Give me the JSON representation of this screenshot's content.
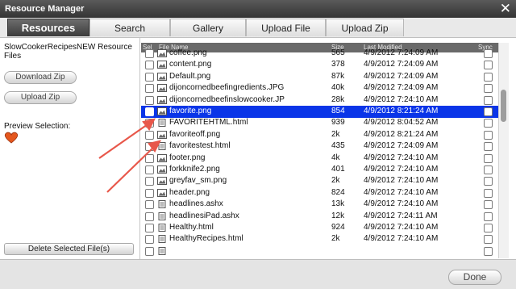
{
  "window": {
    "title": "Resource Manager",
    "close_glyph": "✕"
  },
  "tabs": [
    {
      "label": "Resources",
      "active": true
    },
    {
      "label": "Search",
      "active": false
    },
    {
      "label": "Gallery",
      "active": false
    },
    {
      "label": "Upload File",
      "active": false
    },
    {
      "label": "Upload Zip",
      "active": false
    }
  ],
  "left_panel": {
    "folder_name": "SlowCookerRecipesNEW Resource Files",
    "download_zip_label": "Download Zip",
    "upload_zip_label": "Upload Zip",
    "preview_label": "Preview Selection:",
    "delete_button_label": "Delete Selected File(s)",
    "preview_icon": "heart-icon"
  },
  "table": {
    "headers": {
      "sel": "Sel",
      "file_name": "File Name",
      "size": "Size",
      "last_modified": "Last Modified",
      "sync": "Sync"
    },
    "rows": [
      {
        "name": "coffee.png",
        "size": "565",
        "modified": "4/9/2012 7:24:09 AM",
        "type": "image",
        "selected": false
      },
      {
        "name": "content.png",
        "size": "378",
        "modified": "4/9/2012 7:24:09 AM",
        "type": "image",
        "selected": false
      },
      {
        "name": "Default.png",
        "size": "87k",
        "modified": "4/9/2012 7:24:09 AM",
        "type": "image",
        "selected": false
      },
      {
        "name": "dijoncornedbeefingredients.JPG",
        "size": "40k",
        "modified": "4/9/2012 7:24:09 AM",
        "type": "image",
        "selected": false
      },
      {
        "name": "dijoncornedbeefinslowcooker.JP",
        "size": "28k",
        "modified": "4/9/2012 7:24:10 AM",
        "type": "image",
        "selected": false
      },
      {
        "name": "favorite.png",
        "size": "854",
        "modified": "4/9/2012 8:21:24 AM",
        "type": "image",
        "selected": true
      },
      {
        "name": "FAVORITEHTML.html",
        "size": "939",
        "modified": "4/9/2012 8:04:52 AM",
        "type": "doc",
        "selected": false
      },
      {
        "name": "favoriteoff.png",
        "size": "2k",
        "modified": "4/9/2012 8:21:24 AM",
        "type": "image",
        "selected": false
      },
      {
        "name": "favoritestest.html",
        "size": "435",
        "modified": "4/9/2012 7:24:09 AM",
        "type": "doc",
        "selected": false
      },
      {
        "name": "footer.png",
        "size": "4k",
        "modified": "4/9/2012 7:24:10 AM",
        "type": "image",
        "selected": false
      },
      {
        "name": "forkknife2.png",
        "size": "401",
        "modified": "4/9/2012 7:24:10 AM",
        "type": "image",
        "selected": false
      },
      {
        "name": "greyfav_sm.png",
        "size": "2k",
        "modified": "4/9/2012 7:24:10 AM",
        "type": "image",
        "selected": false
      },
      {
        "name": "header.png",
        "size": "824",
        "modified": "4/9/2012 7:24:10 AM",
        "type": "image",
        "selected": false
      },
      {
        "name": "headlines.ashx",
        "size": "13k",
        "modified": "4/9/2012 7:24:10 AM",
        "type": "doc",
        "selected": false
      },
      {
        "name": "headlinesiPad.ashx",
        "size": "12k",
        "modified": "4/9/2012 7:24:11 AM",
        "type": "doc",
        "selected": false
      },
      {
        "name": "Healthy.html",
        "size": "924",
        "modified": "4/9/2012 7:24:10 AM",
        "type": "doc",
        "selected": false
      },
      {
        "name": "HealthyRecipes.html",
        "size": "2k",
        "modified": "4/9/2012 7:24:10 AM",
        "type": "doc",
        "selected": false
      },
      {
        "name": "",
        "size": "",
        "modified": "",
        "type": "doc",
        "selected": false
      }
    ]
  },
  "footer": {
    "done_label": "Done"
  },
  "colors": {
    "selection": "#0a35e8",
    "annotation_arrow": "#e8574a",
    "active_tab": "#3c3c3c"
  }
}
